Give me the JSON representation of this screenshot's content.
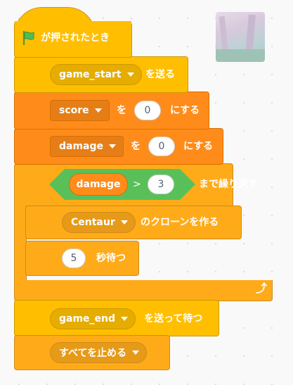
{
  "script": {
    "hat_label": "が押されたとき",
    "broadcast1": {
      "message": "game_start",
      "suffix": "を送る"
    },
    "set_score": {
      "variable": "score",
      "to": "を",
      "value": "0",
      "suffix": "にする"
    },
    "set_damage": {
      "variable": "damage",
      "to": "を",
      "value": "0",
      "suffix": "にする"
    },
    "repeat_until": {
      "variable": "damage",
      "operator": ">",
      "value": "3",
      "suffix": "まで繰り返す",
      "clone": {
        "target": "Centaur",
        "suffix": "のクローンを作る"
      },
      "wait": {
        "value": "5",
        "suffix": "秒待つ"
      }
    },
    "broadcast2": {
      "message": "game_end",
      "suffix": "を送って待つ"
    },
    "stop": {
      "label": "すべてを止める"
    }
  },
  "colors": {
    "events": "#ffbf00",
    "control": "#ffab19",
    "variables": "#ff8c1a",
    "operators": "#59c059",
    "flag": "#4cbf56"
  },
  "icons": [
    "green-flag-icon",
    "loop-arrow-icon",
    "dropdown-caret-icon"
  ]
}
